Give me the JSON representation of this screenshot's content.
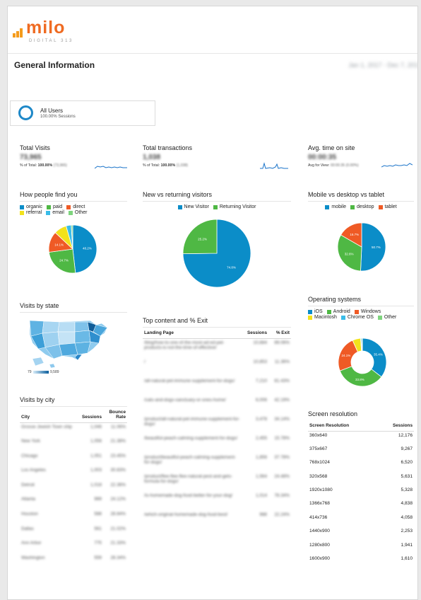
{
  "brand": {
    "name": "milo",
    "tagline": "DIGITAL 313",
    "color": "#ef6b22",
    "bar_color": "#f49b1c"
  },
  "header": {
    "title": "General Information",
    "date_range": "Jan 1, 2017 - Dec 7, 2017"
  },
  "segment": {
    "name": "All Users",
    "sub": "100.00% Sessions",
    "icon": "ring-icon"
  },
  "colors": {
    "blue": "#0b8dc8",
    "green": "#4fb844",
    "orange": "#ef5a25",
    "yellow": "#f2e21b",
    "cyan": "#39bce8",
    "lightgreen": "#7ed47d"
  },
  "metrics": [
    {
      "title": "Total Visits",
      "value": "73,965",
      "sub_prefix": "% of Total:",
      "sub_bold": "100.00%",
      "sub_rest": "(73,965)"
    },
    {
      "title": "Total transactions",
      "value": "1,038",
      "sub_prefix": "% of Total:",
      "sub_bold": "100.00%",
      "sub_rest": "(1,038)"
    },
    {
      "title": "Avg. time on site",
      "value": "00:00:35",
      "sub_prefix": "Avg for View:",
      "sub_bold": "",
      "sub_rest": "00:00:35 (0.00%)"
    }
  ],
  "charts": {
    "find": {
      "title": "How people find you",
      "legend": [
        "organic",
        "paid",
        "direct",
        "referral",
        "email",
        "Other"
      ],
      "chart_data": {
        "type": "pie",
        "categories": [
          "organic",
          "paid",
          "direct",
          "referral",
          "email",
          "Other"
        ],
        "values": [
          48.2,
          24.7,
          14.1,
          8.5,
          3.5,
          1.0
        ],
        "labels": [
          "48.2%",
          "24.7%",
          "14.1%"
        ]
      }
    },
    "returning": {
      "title": "New vs returning visitors",
      "legend": [
        "New Visitor",
        "Returning Visitor"
      ],
      "chart_data": {
        "type": "pie",
        "categories": [
          "New Visitor",
          "Returning Visitor"
        ],
        "values": [
          74.8,
          25.2
        ],
        "labels": [
          "74.8%",
          "25.2%"
        ]
      }
    },
    "device": {
      "title": "Mobile vs desktop vs tablet",
      "legend": [
        "mobile",
        "desktop",
        "tablet"
      ],
      "chart_data": {
        "type": "pie",
        "categories": [
          "mobile",
          "desktop",
          "tablet"
        ],
        "values": [
          50.7,
          32.6,
          16.7
        ],
        "labels": [
          "50.7%",
          "32.6%",
          "16.7%"
        ]
      }
    },
    "os": {
      "title": "Operating systems",
      "legend": [
        "iOS",
        "Android",
        "Windows",
        "Macintosh",
        "Chrome OS",
        "Other"
      ],
      "chart_data": {
        "type": "pie",
        "categories": [
          "iOS",
          "Android",
          "Windows",
          "Macintosh",
          "Chrome OS",
          "Other"
        ],
        "values": [
          35.4,
          33.8,
          24.1,
          5.5,
          0.7,
          0.5
        ],
        "labels": [
          "35.4%",
          "33.8%",
          "24.1%"
        ]
      }
    }
  },
  "state": {
    "title": "Visits by state",
    "scale_min": "79",
    "scale_max": "9,589"
  },
  "city": {
    "title": "Visits by city",
    "columns": [
      "City",
      "Sessions",
      "Bounce Rate"
    ],
    "rows": [
      [
        "Grosse Jewish Town ship",
        "1,046",
        "11.06%"
      ],
      [
        "New York",
        "1,056",
        "21.38%"
      ],
      [
        "Chicago",
        "1,051",
        "23.45%"
      ],
      [
        "Los Angeles",
        "1,003",
        "30.83%"
      ],
      [
        "Detroit",
        "1,018",
        "22.36%"
      ],
      [
        "Atlanta",
        "989",
        "24.12%"
      ],
      [
        "Houston",
        "588",
        "28.84%"
      ],
      [
        "Dallas",
        "561",
        "21.02%"
      ],
      [
        "Ann Arbor",
        "775",
        "21.33%"
      ],
      [
        "Washington",
        "559",
        "28.34%"
      ]
    ]
  },
  "content": {
    "title": "Top content and % Exit",
    "columns": [
      "Landing Page",
      "Sessions",
      "% Exit"
    ],
    "rows": [
      [
        "/blog/how-to-one-of-the-most-ad-ed-pet-products-is-not-the-time-of-effective/",
        "10,684",
        "89.06%"
      ],
      [
        "/",
        "10,853",
        "11.36%"
      ],
      [
        "/all-natural-pet-immune-supplement-for-dogs/",
        "7,210",
        "81.43%"
      ],
      [
        "/cats-and-dogs-sanctuary-or-ones-home/",
        "6,006",
        "42.19%"
      ],
      [
        "/product/all-natural-pet-immune-supplement-for-dogs/",
        "3,478",
        "34.14%"
      ],
      [
        "/beautiful-peach-calming-supplement-for-dogs/",
        "2,455",
        "15.78%"
      ],
      [
        "/product/beautiful-peach-calming-supplement-for-dogs/",
        "1,856",
        "37.78%"
      ],
      [
        "/product/flee-flee-flee-natural-pest-and-gets-formula-for-dogs/",
        "1,564",
        "24.48%"
      ],
      [
        "/is-homemade-dog-food-better-for-your-dog/",
        "1,014",
        "78.34%"
      ],
      [
        "/which-original-homemade-dog-food-best/",
        "988",
        "22.24%"
      ]
    ]
  },
  "screen": {
    "title": "Screen resolution",
    "columns": [
      "Screen Resolution",
      "Sessions"
    ],
    "rows": [
      [
        "360x640",
        "12,176"
      ],
      [
        "375x667",
        "9,267"
      ],
      [
        "768x1024",
        "6,520"
      ],
      [
        "320x568",
        "5,631"
      ],
      [
        "1920x1080",
        "5,328"
      ],
      [
        "1366x768",
        "4,838"
      ],
      [
        "414x736",
        "4,058"
      ],
      [
        "1440x900",
        "2,253"
      ],
      [
        "1280x800",
        "1,941"
      ],
      [
        "1600x900",
        "1,610"
      ]
    ]
  }
}
